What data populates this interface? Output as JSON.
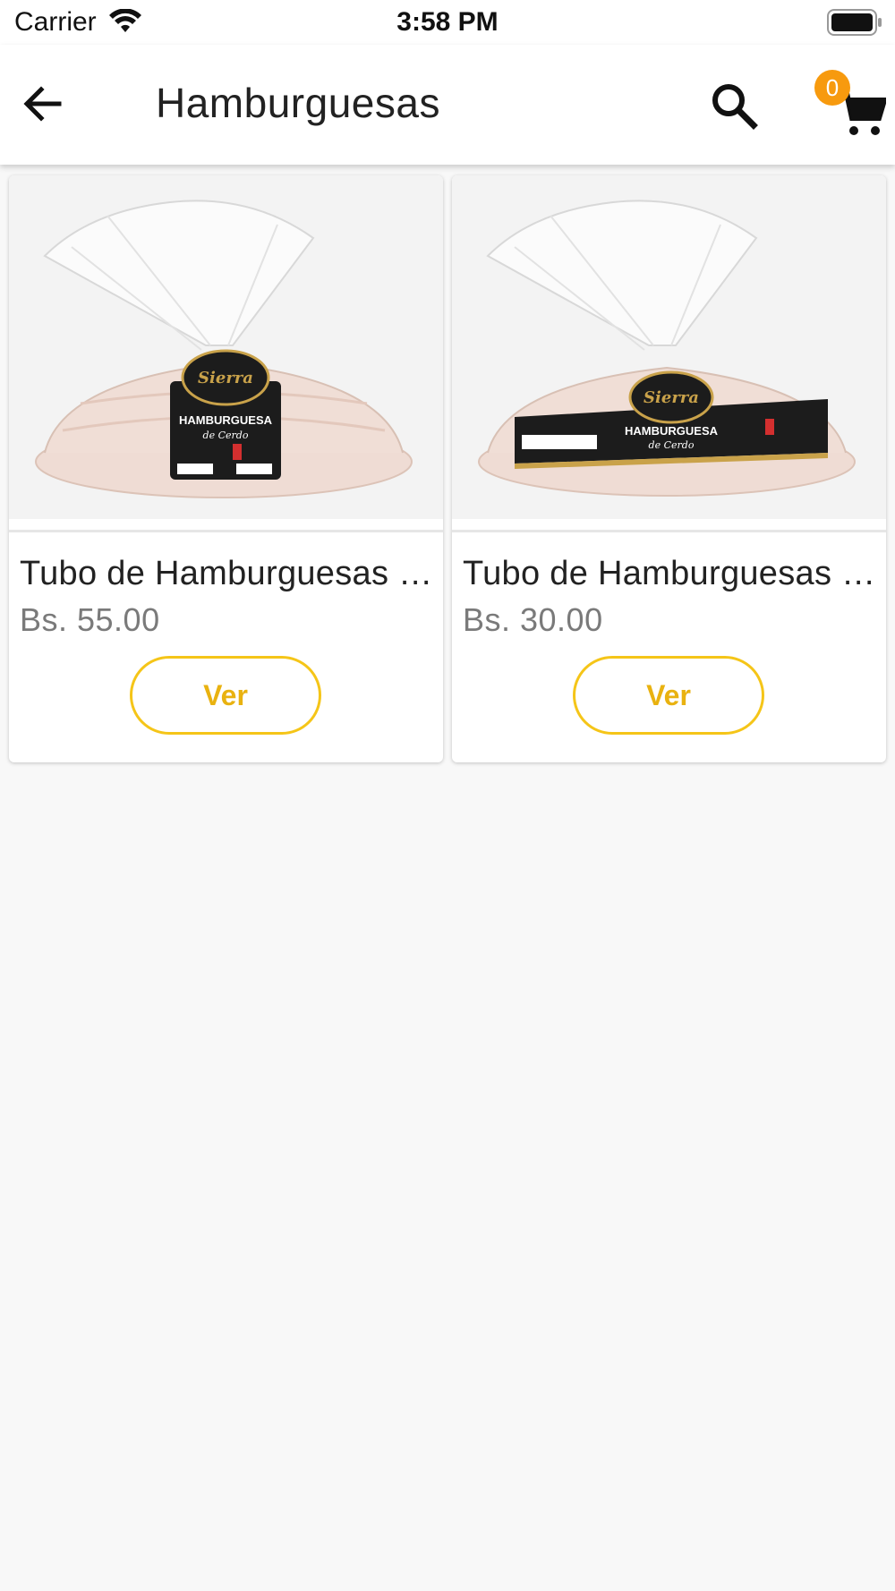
{
  "status_bar": {
    "carrier": "Carrier",
    "time": "3:58 PM",
    "icons": [
      "wifi-icon",
      "battery-icon"
    ]
  },
  "app_bar": {
    "title": "Hamburguesas",
    "back_icon": "arrow-left-icon",
    "search_icon": "search-icon",
    "cart_icon": "cart-icon",
    "cart_count": "0"
  },
  "products": [
    {
      "name": "Tubo de Hamburguesas de Cerdo",
      "price": "Bs. 55.00",
      "button_label": "Ver",
      "image_label": {
        "brand": "la Sierra",
        "line1": "HAMBURGUESA",
        "line2": "de Cerdo"
      }
    },
    {
      "name": "Tubo de Hamburguesas de Cerdo",
      "price": "Bs. 30.00",
      "button_label": "Ver",
      "image_label": {
        "brand": "la Sierra",
        "line1": "HAMBURGUESA",
        "line2": "de Cerdo"
      }
    }
  ],
  "colors": {
    "accent": "#f5c518",
    "badge": "#f79a0e",
    "label_dark": "#1c1c1c",
    "label_gold": "#c9a24a"
  }
}
